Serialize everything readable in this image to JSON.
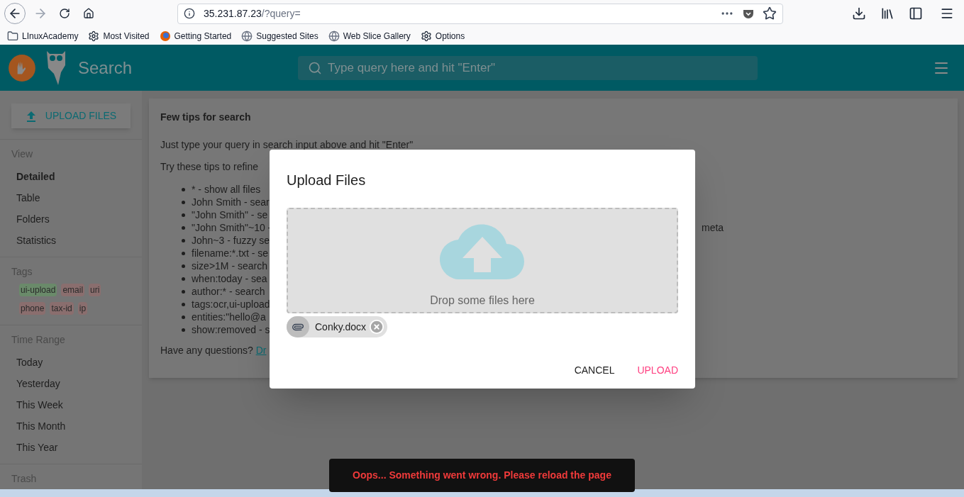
{
  "browser": {
    "url_host": "35.231.87.23",
    "url_path": "/?query=",
    "bookmarks": [
      {
        "label": "LInuxAcademy",
        "kind": "folder"
      },
      {
        "label": "Most Visited",
        "kind": "gear"
      },
      {
        "label": "Getting Started",
        "kind": "firefox"
      },
      {
        "label": "Suggested Sites",
        "kind": "globe"
      },
      {
        "label": "Web Slice Gallery",
        "kind": "globe"
      },
      {
        "label": "Options",
        "kind": "gear"
      }
    ]
  },
  "header": {
    "title": "Search",
    "search_placeholder": "Type query here and hit \"Enter\""
  },
  "sidebar": {
    "upload_button": "UPLOAD FILES",
    "sections": [
      {
        "title": "View",
        "kind": "list",
        "items": [
          {
            "label": "Detailed",
            "selected": true
          },
          {
            "label": "Table",
            "selected": false
          },
          {
            "label": "Folders",
            "selected": false
          },
          {
            "label": "Statistics",
            "selected": false
          }
        ]
      },
      {
        "title": "Tags",
        "kind": "tags",
        "items": [
          {
            "label": "ui-upload",
            "color": "#6a8a6a"
          },
          {
            "label": "email",
            "color": "#8a6e6e"
          },
          {
            "label": "uri",
            "color": "#8a6e6e"
          },
          {
            "label": "phone",
            "color": "#8a6e6e"
          },
          {
            "label": "tax-id",
            "color": "#8a6e6e"
          },
          {
            "label": "ip",
            "color": "#8a6e6e"
          }
        ]
      },
      {
        "title": "Time Range",
        "kind": "list",
        "items": [
          {
            "label": "Today",
            "selected": false
          },
          {
            "label": "Yesterday",
            "selected": false
          },
          {
            "label": "This Week",
            "selected": false
          },
          {
            "label": "This Month",
            "selected": false
          },
          {
            "label": "This Year",
            "selected": false
          }
        ]
      },
      {
        "title": "Trash",
        "kind": "list"
      }
    ]
  },
  "tips_card": {
    "title": "Few tips for search",
    "intro": "Just type your query in search input above and hit \"Enter\"",
    "refine": "Try these tips to refine",
    "tips": [
      {
        "text": "* - show all files"
      },
      {
        "text": "John Smith - sear"
      },
      {
        "text": "\"John Smith\" - se"
      },
      {
        "text": "\"John Smith\"~10 -",
        "tail": "meta"
      },
      {
        "text": "John~3 - fuzzy se"
      },
      {
        "text": "filename:*.txt - se"
      },
      {
        "text": "size>1M - search"
      },
      {
        "text": "when:today - sea"
      },
      {
        "text": "author:* - search"
      },
      {
        "text": "tags:ocr,ui-upload"
      },
      {
        "text": "entities:\"hello@a"
      },
      {
        "text": "show:removed - s"
      }
    ],
    "question": "Have any questions?",
    "link": "Dr"
  },
  "dialog": {
    "title": "Upload Files",
    "dropzone_text": "Drop some files here",
    "files": [
      {
        "name": "Conky.docx"
      }
    ],
    "buttons": [
      {
        "label": "CANCEL",
        "kind": "plain"
      },
      {
        "label": "UPLOAD",
        "kind": "primary"
      }
    ]
  },
  "snackbar": {
    "message": "Oops... Something went wrong. Please reload the page"
  }
}
